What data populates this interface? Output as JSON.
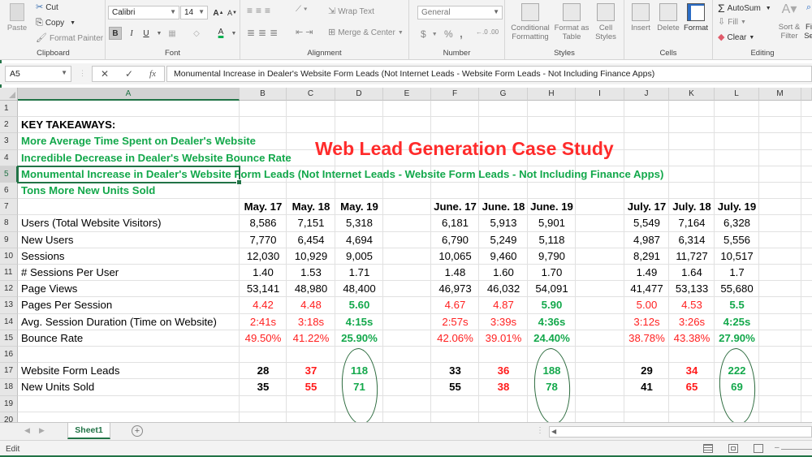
{
  "ribbon": {
    "clipboard": {
      "label": "Clipboard",
      "paste": "Paste",
      "cut": "Cut",
      "copy": "Copy",
      "format_painter": "Format Painter"
    },
    "font": {
      "label": "Font",
      "font_name": "Calibri",
      "font_size": "14",
      "bold": "B",
      "italic": "I",
      "underline": "U",
      "grow": "A",
      "shrink": "A",
      "font_color_accent": "#00b050"
    },
    "alignment": {
      "label": "Alignment",
      "wrap_text": "Wrap Text",
      "merge_center": "Merge & Center"
    },
    "number": {
      "label": "Number",
      "format": "General",
      "currency": "$",
      "percent": "%",
      "comma": ","
    },
    "styles": {
      "label": "Styles",
      "conditional_formatting": [
        "Conditional",
        "Formatting"
      ],
      "format_as_table": [
        "Format as",
        "Table"
      ],
      "cell_styles": [
        "Cell",
        "Styles"
      ]
    },
    "cells": {
      "label": "Cells",
      "insert": "Insert",
      "delete": "Delete",
      "format": "Format"
    },
    "editing": {
      "label": "Editing",
      "autosum": "AutoSum",
      "fill": "Fill",
      "clear": "Clear",
      "sort_filter": [
        "Sort &",
        "Filter"
      ],
      "find_select": [
        "Fi",
        "Se"
      ]
    }
  },
  "formula_bar": {
    "name_box": "A5",
    "cancel": "✕",
    "enter": "✓",
    "fx": "fx",
    "value": "Monumental Increase in Dealer's Website Form Leads (Not Internet Leads - Website Form Leads - Not Including Finance Apps)"
  },
  "grid": {
    "selected_column": "A",
    "columns": [
      "A",
      "B",
      "C",
      "D",
      "E",
      "F",
      "G",
      "H",
      "I",
      "J",
      "K",
      "L",
      "M"
    ],
    "rows": [
      "1",
      "2",
      "3",
      "4",
      "5",
      "6",
      "7",
      "8",
      "9",
      "10",
      "11",
      "12",
      "13",
      "14",
      "15",
      "16",
      "17",
      "18",
      "19",
      "20"
    ],
    "title_overlay": "Web Lead Generation Case Study",
    "takeaways": {
      "heading": "KEY TAKEAWAYS:",
      "items": [
        "More Average Time Spent on Dealer's Website",
        "Incredible Decrease in Dealer's Website Bounce Rate",
        "Monumental Increase in Dealer's Website Form Leads (Not Internet Leads - Website Form Leads - Not Including Finance Apps)",
        "Tons More New Units Sold"
      ]
    },
    "period_headers": [
      "May. 17",
      "May. 18",
      "May. 19",
      "June. 17",
      "June. 18",
      "June. 19",
      "July. 17",
      "July. 18",
      "July. 19"
    ],
    "metrics": [
      {
        "label": "Users (Total Website Visitors)",
        "values": [
          "8,586",
          "7,151",
          "5,318",
          "6,181",
          "5,913",
          "5,901",
          "5,549",
          "7,164",
          "6,328"
        ],
        "style": "plain"
      },
      {
        "label": "New Users",
        "values": [
          "7,770",
          "6,454",
          "4,694",
          "6,790",
          "5,249",
          "5,118",
          "4,987",
          "6,314",
          "5,556"
        ],
        "style": "plain"
      },
      {
        "label": "Sessions",
        "values": [
          "12,030",
          "10,929",
          "9,005",
          "10,065",
          "9,460",
          "9,790",
          "8,291",
          "11,727",
          "10,517"
        ],
        "style": "plain"
      },
      {
        "label": "# Sessions Per User",
        "values": [
          "1.40",
          "1.53",
          "1.71",
          "1.48",
          "1.60",
          "1.70",
          "1.49",
          "1.64",
          "1.7"
        ],
        "style": "plain"
      },
      {
        "label": "Page Views",
        "values": [
          "53,141",
          "48,980",
          "48,400",
          "46,973",
          "46,032",
          "54,091",
          "41,477",
          "53,133",
          "55,680"
        ],
        "style": "plain"
      },
      {
        "label": "Pages Per Session",
        "values": [
          "4.42",
          "4.48",
          "5.60",
          "4.67",
          "4.87",
          "5.90",
          "5.00",
          "4.53",
          "5.5"
        ],
        "style": "highlight"
      },
      {
        "label": "Avg. Session Duration (Time on Website)",
        "values": [
          "2:41s",
          "3:18s",
          "4:15s",
          "2:57s",
          "3:39s",
          "4:36s",
          "3:12s",
          "3:26s",
          "4:25s"
        ],
        "style": "highlight"
      },
      {
        "label": "Bounce Rate",
        "values": [
          "49.50%",
          "41.22%",
          "25.90%",
          "42.06%",
          "39.01%",
          "24.40%",
          "38.78%",
          "43.38%",
          "27.90%"
        ],
        "style": "highlight"
      }
    ],
    "results": [
      {
        "label": "Website Form Leads",
        "values": [
          "28",
          "37",
          "118",
          "33",
          "36",
          "188",
          "29",
          "34",
          "222"
        ]
      },
      {
        "label": "New Units Sold",
        "values": [
          "35",
          "55",
          "71",
          "55",
          "38",
          "78",
          "41",
          "65",
          "69"
        ]
      }
    ],
    "colors": {
      "improved": "#13a84b",
      "prior": "#ff2020",
      "title": "#ff2b2b",
      "excel_green": "#217346"
    }
  },
  "sheet_tabs": {
    "tabs": [
      "Sheet1"
    ],
    "active": "Sheet1",
    "add": "+"
  },
  "status_bar": {
    "mode": "Edit"
  }
}
